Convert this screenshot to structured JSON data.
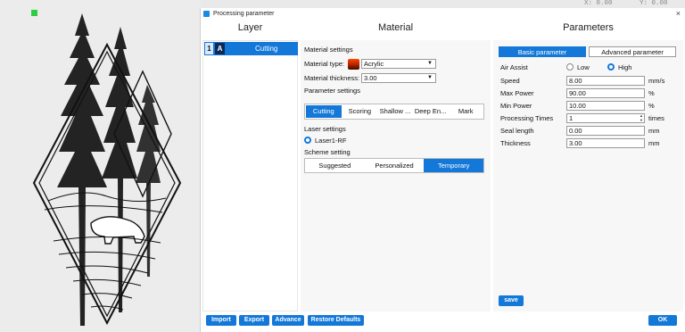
{
  "coords": {
    "x": "X: 0.00",
    "y": "Y: 0.00"
  },
  "dialog": {
    "title": "Processing parameter",
    "close": "×"
  },
  "headers": {
    "layer": "Layer",
    "material": "Material",
    "parameters": "Parameters"
  },
  "layers": [
    {
      "num": "1",
      "mode": "A",
      "name": "Cutting"
    }
  ],
  "material": {
    "settings_title": "Material settings",
    "type_label": "Material type:",
    "type_value": "Acrylic",
    "thickness_label": "Material thickness:",
    "thickness_value": "3.00",
    "param_settings_title": "Parameter settings",
    "param_tabs": [
      "Cutting",
      "Scoring",
      "Shallow ...",
      "Deep En...",
      "Mark"
    ],
    "laser_settings_title": "Laser settings",
    "laser_name": "Laser1-RF",
    "scheme_title": "Scheme setting",
    "schemes": [
      "Suggested",
      "Personalized",
      "Temporary"
    ]
  },
  "params": {
    "tabs": [
      "Basic parameter",
      "Advanced parameter"
    ],
    "air_assist_label": "Air Assist",
    "air_low": "Low",
    "air_high": "High",
    "fields": [
      {
        "label": "Speed",
        "value": "8.00",
        "unit": "mm/s"
      },
      {
        "label": "Max Power",
        "value": "90.00",
        "unit": "%"
      },
      {
        "label": "Min Power",
        "value": "10.00",
        "unit": "%"
      },
      {
        "label": "Processing Times",
        "value": "1",
        "unit": "times"
      },
      {
        "label": "Seal length",
        "value": "0.00",
        "unit": "mm"
      },
      {
        "label": "Thickness",
        "value": "3.00",
        "unit": "mm"
      }
    ],
    "save": "save"
  },
  "footer": {
    "import": "Import",
    "export": "Export",
    "advance": "Advance",
    "restore": "Restore Defaults",
    "ok": "OK"
  },
  "colors": {
    "accent": "#1378d8"
  },
  "icons": {
    "app": "app-icon",
    "close": "close-icon",
    "marker": "selection-marker"
  }
}
